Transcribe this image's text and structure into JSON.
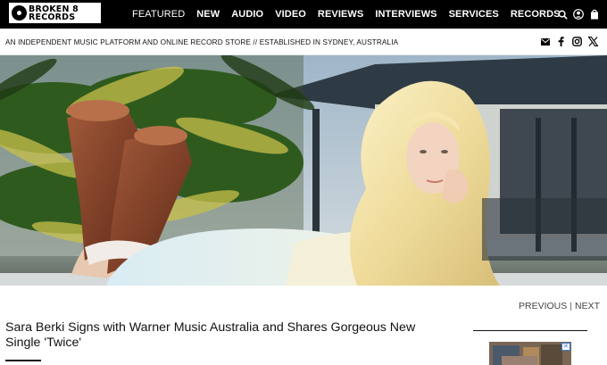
{
  "brand": {
    "logo_line1": "BROKEN 8",
    "logo_line2": "RECORDS"
  },
  "nav": {
    "items": [
      {
        "label": "FEATURED",
        "active": true
      },
      {
        "label": "NEW"
      },
      {
        "label": "AUDIO"
      },
      {
        "label": "VIDEO"
      },
      {
        "label": "REVIEWS"
      },
      {
        "label": "INTERVIEWS"
      },
      {
        "label": "SERVICES"
      },
      {
        "label": "RECORDS"
      }
    ],
    "icons": [
      "search-icon",
      "user-icon",
      "shopping-bag-icon"
    ]
  },
  "strapline": {
    "text": "AN INDEPENDENT MUSIC PLATFORM AND ONLINE RECORD STORE // ESTABLISHED IN SYDNEY, AUSTRALIA",
    "social_icons": [
      "email-icon",
      "facebook-icon",
      "instagram-icon",
      "x-icon"
    ]
  },
  "article": {
    "pager": {
      "previous": "PREVIOUS",
      "separator": "|",
      "next": "NEXT"
    },
    "title": "Sara Berki Signs with Warner Music Australia and Shares Gorgeous New Single 'Twice'"
  },
  "colors": {
    "header_bg": "#000000",
    "text": "#111111",
    "accent_blue": "#3a7bd5"
  }
}
